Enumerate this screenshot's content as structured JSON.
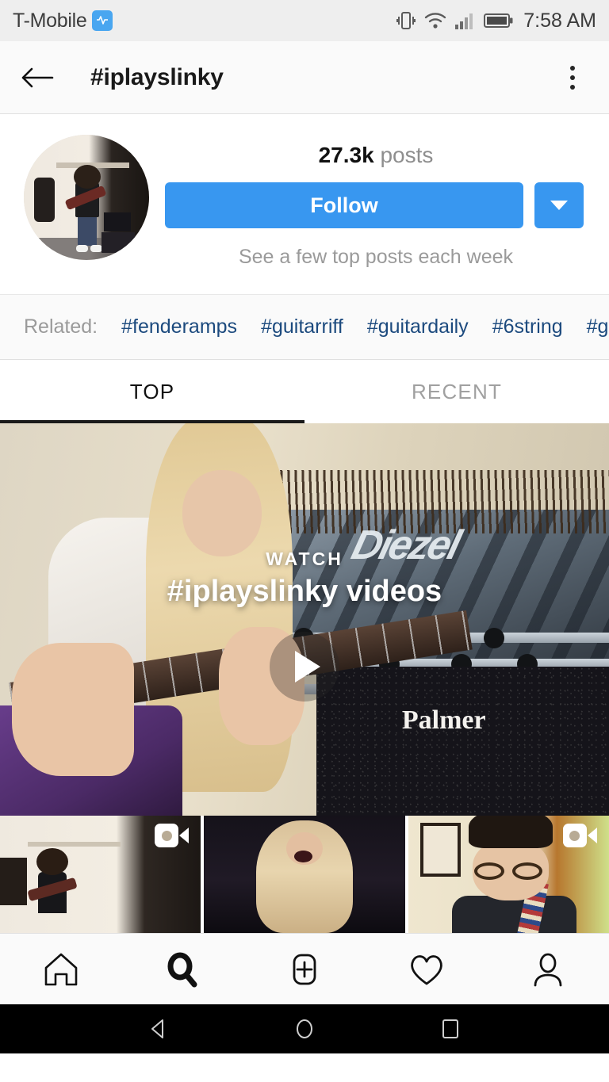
{
  "status_bar": {
    "carrier": "T-Mobile",
    "badge_icon": "messaging-badge-icon",
    "icons": [
      "vibrate-icon",
      "wifi-icon",
      "cellular-signal-icon",
      "battery-icon"
    ],
    "time": "7:58 AM"
  },
  "app_bar": {
    "back_icon": "back-arrow-icon",
    "title": "#iplayslinky",
    "overflow_icon": "more-options-icon"
  },
  "profile": {
    "avatar_alt": "hashtag-avatar",
    "post_count": "27.3k",
    "post_label": "posts",
    "follow_label": "Follow",
    "more_icon": "chevron-down-icon",
    "subtitle": "See a few top posts each week",
    "accent_color": "#3897f0"
  },
  "related": {
    "label": "Related:",
    "tags": [
      "#fenderamps",
      "#guitarriff",
      "#guitardaily",
      "#6string",
      "#gibson"
    ]
  },
  "tabs": [
    {
      "label": "TOP",
      "active": true
    },
    {
      "label": "RECENT",
      "active": false
    }
  ],
  "hero": {
    "watch_label": "WATCH",
    "title": "#iplayslinky videos",
    "play_icon": "play-icon",
    "amp_brand": "Diezel",
    "cabinet_brand": "Palmer"
  },
  "grid": [
    {
      "alt": "post-thumbnail-1",
      "is_video": true,
      "video_icon": "video-camera-icon"
    },
    {
      "alt": "post-thumbnail-2",
      "is_video": false,
      "video_icon": ""
    },
    {
      "alt": "post-thumbnail-3",
      "is_video": true,
      "video_icon": "video-camera-icon"
    }
  ],
  "bottom_nav": [
    {
      "name": "home-icon",
      "active": false
    },
    {
      "name": "search-icon",
      "active": true
    },
    {
      "name": "add-post-icon",
      "active": false
    },
    {
      "name": "activity-heart-icon",
      "active": false
    },
    {
      "name": "profile-icon",
      "active": false
    }
  ],
  "android_nav": [
    {
      "name": "android-back-icon"
    },
    {
      "name": "android-home-icon"
    },
    {
      "name": "android-recents-icon"
    }
  ]
}
